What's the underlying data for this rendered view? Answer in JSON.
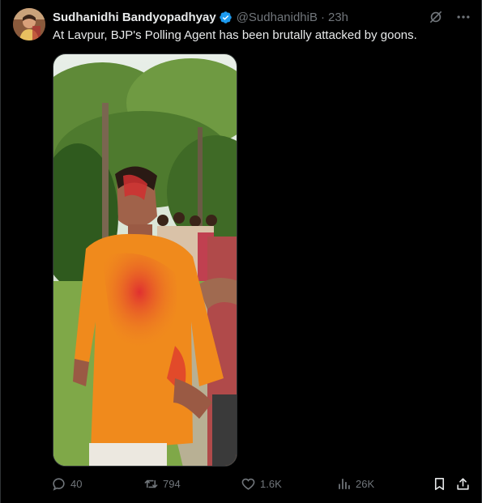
{
  "tweet": {
    "display_name": "Sudhanidhi Bandyopadhyay",
    "handle": "@SudhanidhiB",
    "separator": "·",
    "time": "23h",
    "text": "At Lavpur, BJP's Polling Agent has been brutally attacked by goons.",
    "verified": true,
    "avatar_icon": "avatar-photo",
    "top_icons": [
      "grok-icon",
      "more-icon"
    ],
    "media_description_icon": "photo"
  },
  "actions": {
    "reply_count": "40",
    "retweet_count": "794",
    "like_count": "1.6K",
    "views_count": "26K",
    "icons": [
      "reply-icon",
      "retweet-icon",
      "heart-icon",
      "views-icon",
      "bookmark-icon",
      "share-icon"
    ]
  },
  "colors": {
    "background": "#000000",
    "text_primary": "#e7e9ea",
    "text_secondary": "#71767b",
    "verified_blue": "#1d9bf0",
    "border": "#2f3336"
  }
}
